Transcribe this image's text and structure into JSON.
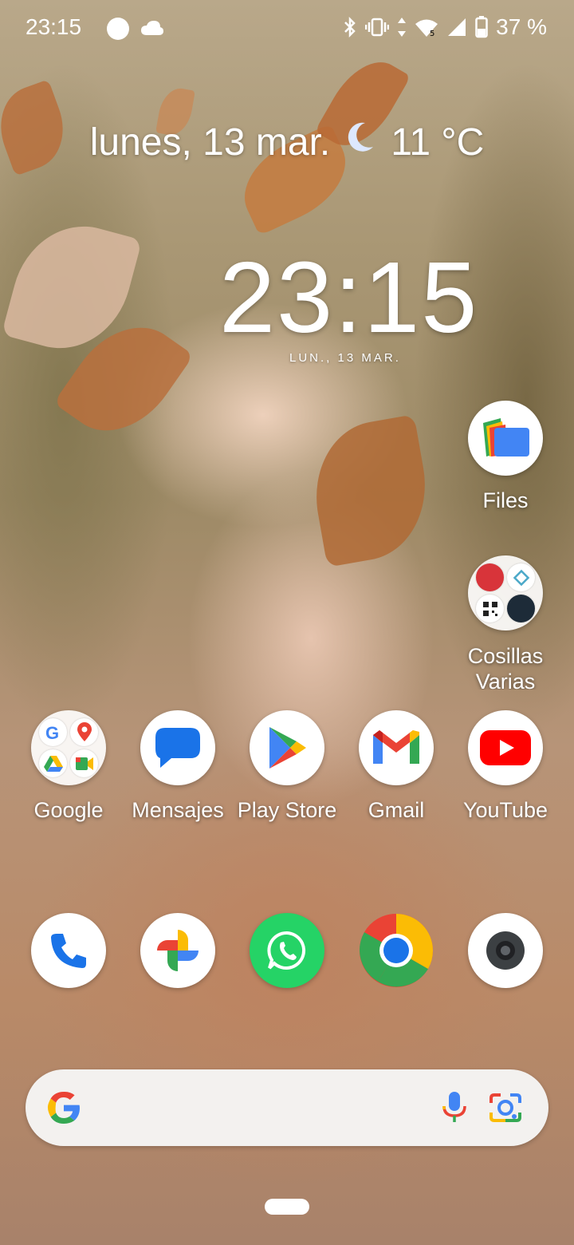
{
  "status_bar": {
    "time": "23:15",
    "battery": "37 %",
    "icons": [
      "circle-icon",
      "cloud-icon",
      "bluetooth-icon",
      "vibrate-icon",
      "data-arrows-icon",
      "wifi-icon",
      "signal-icon",
      "battery-icon"
    ]
  },
  "date_weather": {
    "date": "lunes, 13 mar.",
    "weather_icon": "moon-icon",
    "temperature": "11 °C"
  },
  "clock_widget": {
    "time": "23:15",
    "date": "LUN., 13 MAR."
  },
  "side_apps": [
    {
      "label": "Files",
      "icon": "files-icon"
    },
    {
      "label": "Cosillas Varias",
      "icon": "folder-icon"
    }
  ],
  "row_apps": [
    {
      "label": "Google",
      "icon": "google-folder-icon"
    },
    {
      "label": "Mensajes",
      "icon": "messages-icon"
    },
    {
      "label": "Play Store",
      "icon": "play-store-icon"
    },
    {
      "label": "Gmail",
      "icon": "gmail-icon"
    },
    {
      "label": "YouTube",
      "icon": "youtube-icon"
    }
  ],
  "dock_apps": [
    {
      "icon": "phone-icon"
    },
    {
      "icon": "photos-icon"
    },
    {
      "icon": "whatsapp-icon"
    },
    {
      "icon": "chrome-icon"
    },
    {
      "icon": "camera-icon"
    }
  ],
  "search_bar": {
    "icons": [
      "google-g-icon",
      "mic-icon",
      "lens-icon"
    ]
  },
  "colors": {
    "google_blue": "#4285F4",
    "google_red": "#EA4335",
    "google_yellow": "#FBBC05",
    "google_green": "#34A853",
    "whatsapp_green": "#25D366",
    "youtube_red": "#FF0000"
  }
}
